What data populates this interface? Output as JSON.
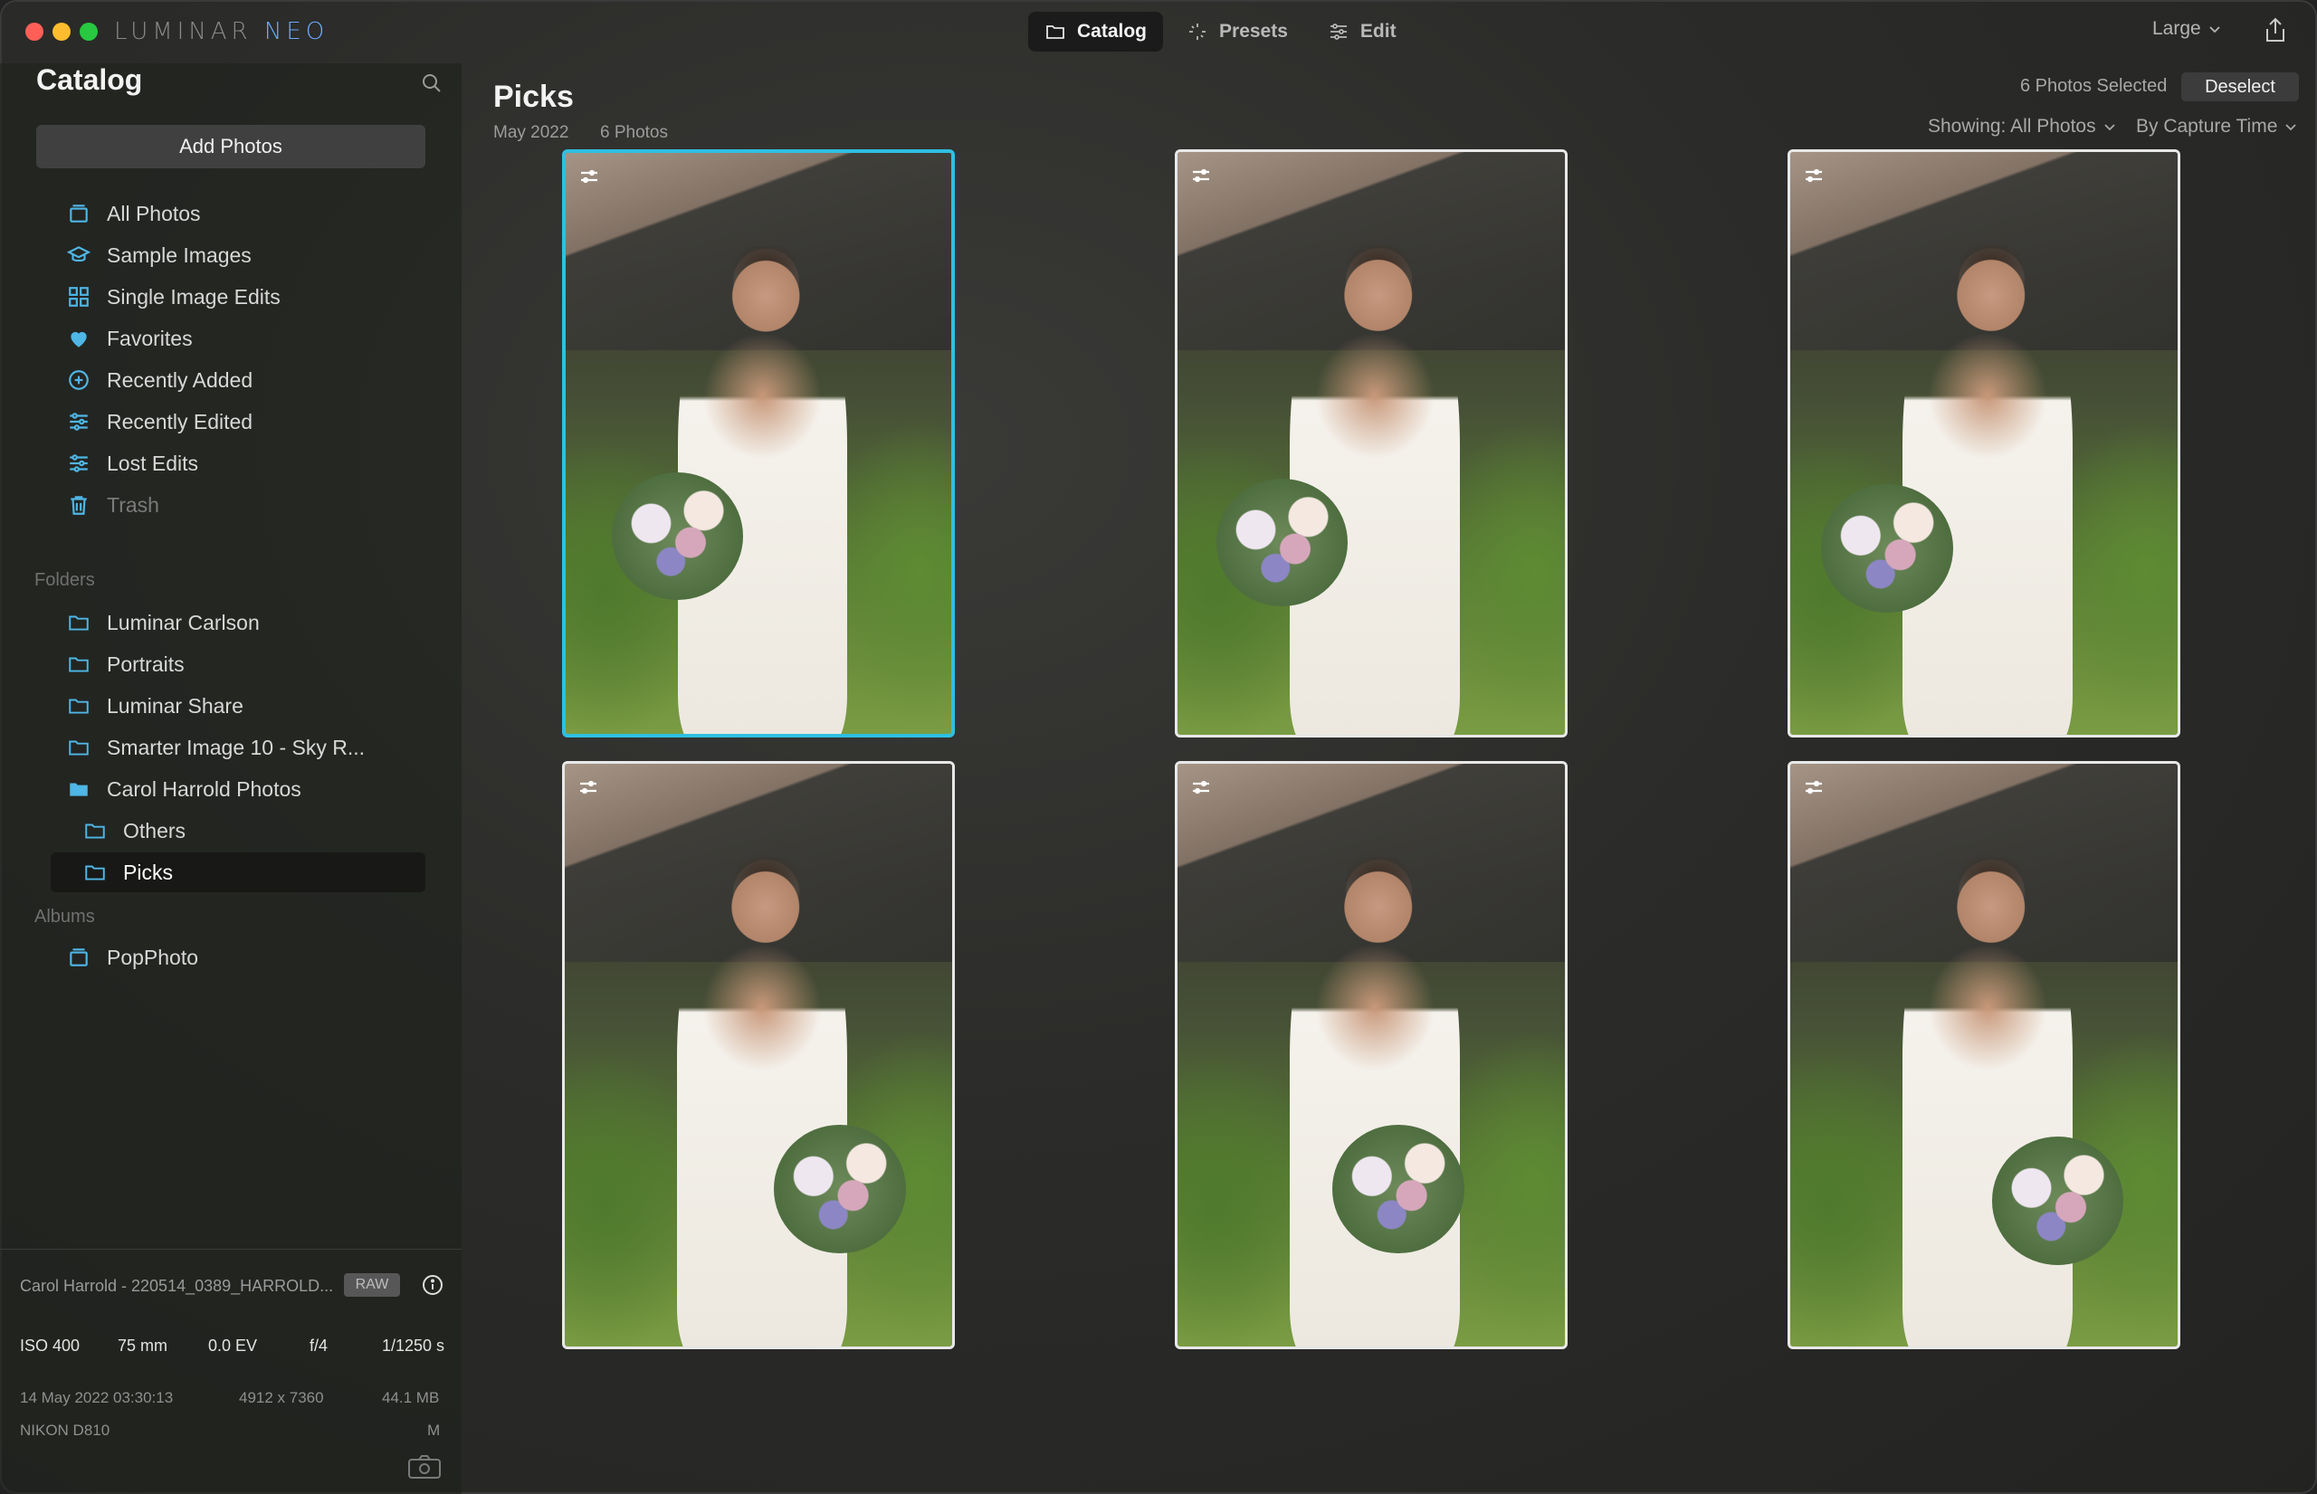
{
  "app": {
    "brand_main": "LUMINAR",
    "brand_accent": "NEO",
    "accent_color": "#2ec0e2"
  },
  "modes": [
    {
      "label": "Catalog",
      "icon": "folder-icon",
      "active": true
    },
    {
      "label": "Presets",
      "icon": "sparkle-icon",
      "active": false
    },
    {
      "label": "Edit",
      "icon": "sliders-icon",
      "active": false
    }
  ],
  "toolbar": {
    "size_label": "Large",
    "share_icon": "share-icon"
  },
  "sidebar": {
    "title": "Catalog",
    "add_button": "Add Photos",
    "items": [
      {
        "label": "All Photos",
        "icon": "all-photos-icon"
      },
      {
        "label": "Sample Images",
        "icon": "graduation-cap-icon"
      },
      {
        "label": "Single Image Edits",
        "icon": "grid-icon"
      },
      {
        "label": "Favorites",
        "icon": "heart-icon"
      },
      {
        "label": "Recently Added",
        "icon": "plus-circle-icon"
      },
      {
        "label": "Recently Edited",
        "icon": "sliders-icon"
      },
      {
        "label": "Lost Edits",
        "icon": "sliders-icon"
      },
      {
        "label": "Trash",
        "icon": "trash-icon"
      }
    ],
    "folders_label": "Folders",
    "folders": [
      {
        "label": "Luminar Carlson"
      },
      {
        "label": "Portraits"
      },
      {
        "label": "Luminar Share"
      },
      {
        "label": "Smarter Image 10 - Sky R..."
      },
      {
        "label": "Carol Harrold Photos"
      },
      {
        "label": "Others"
      },
      {
        "label": "Picks"
      }
    ],
    "albums_label": "Albums",
    "albums": [
      {
        "label": "PopPhoto"
      }
    ]
  },
  "info": {
    "filename": "Carol Harrold - 220514_0389_HARROLD...",
    "format_badge": "RAW",
    "iso": "ISO 400",
    "focal": "75 mm",
    "ev": "0.0 EV",
    "aperture": "f/4",
    "shutter": "1/1250 s",
    "date": "14 May 2022 03:30:13",
    "dimensions": "4912 x 7360",
    "filesize": "44.1 MB",
    "camera": "NIKON D810",
    "mode": "M"
  },
  "main": {
    "title": "Picks",
    "date": "May 2022",
    "count": "6 Photos",
    "selected_count": "6 Photos Selected",
    "deselect": "Deselect",
    "showing": "Showing: All Photos",
    "sort": "By Capture Time"
  },
  "photos": [
    {
      "name": "photo-1",
      "selected": true
    },
    {
      "name": "photo-2",
      "selected": false
    },
    {
      "name": "photo-3",
      "selected": false
    },
    {
      "name": "photo-4",
      "selected": false
    },
    {
      "name": "photo-5",
      "selected": false
    },
    {
      "name": "photo-6",
      "selected": false
    }
  ]
}
